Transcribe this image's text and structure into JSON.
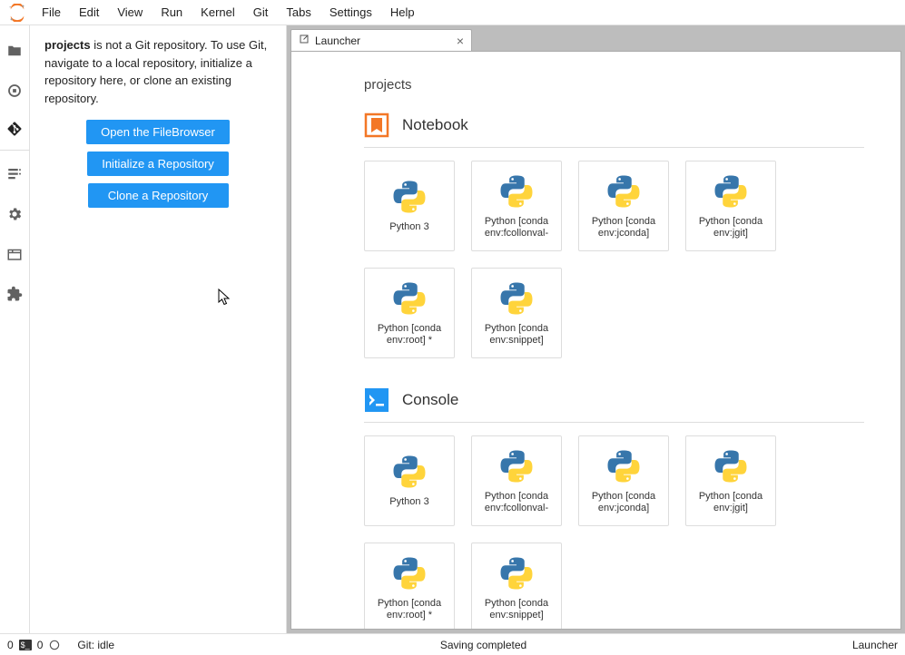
{
  "menubar": {
    "items": [
      "File",
      "Edit",
      "View",
      "Run",
      "Kernel",
      "Git",
      "Tabs",
      "Settings",
      "Help"
    ]
  },
  "iconrail": {
    "items": [
      {
        "name": "folder-icon"
      },
      {
        "name": "running-icon"
      },
      {
        "name": "git-icon"
      },
      {
        "name": "commands-icon"
      },
      {
        "name": "build-icon"
      },
      {
        "name": "tabs-icon"
      },
      {
        "name": "extension-icon"
      }
    ]
  },
  "gitpanel": {
    "message_prefix": "projects",
    "message_rest": " is not a Git repository. To use Git, navigate to a local repository, initialize a repository here, or clone an existing repository.",
    "open_filebrowser": "Open the FileBrowser",
    "init_repo": "Initialize a Repository",
    "clone_repo": "Clone a Repository"
  },
  "tab": {
    "label": "Launcher"
  },
  "launcher": {
    "cwd": "projects",
    "sections": [
      {
        "title": "Notebook",
        "icon": "notebook",
        "cards": [
          {
            "label": "Python 3"
          },
          {
            "label": "Python [conda env:fcollonval-"
          },
          {
            "label": "Python [conda env:jconda]"
          },
          {
            "label": "Python [conda env:jgit]"
          },
          {
            "label": "Python [conda env:root] *"
          },
          {
            "label": "Python [conda env:snippet]"
          }
        ]
      },
      {
        "title": "Console",
        "icon": "console",
        "cards": [
          {
            "label": "Python 3"
          },
          {
            "label": "Python [conda env:fcollonval-"
          },
          {
            "label": "Python [conda env:jconda]"
          },
          {
            "label": "Python [conda env:jgit]"
          },
          {
            "label": "Python [conda env:root] *"
          },
          {
            "label": "Python [conda env:snippet]"
          }
        ]
      }
    ]
  },
  "statusbar": {
    "term_count_left": "0",
    "kernel_count": "0",
    "git_status": "Git: idle",
    "center": "Saving completed",
    "right": "Launcher"
  }
}
